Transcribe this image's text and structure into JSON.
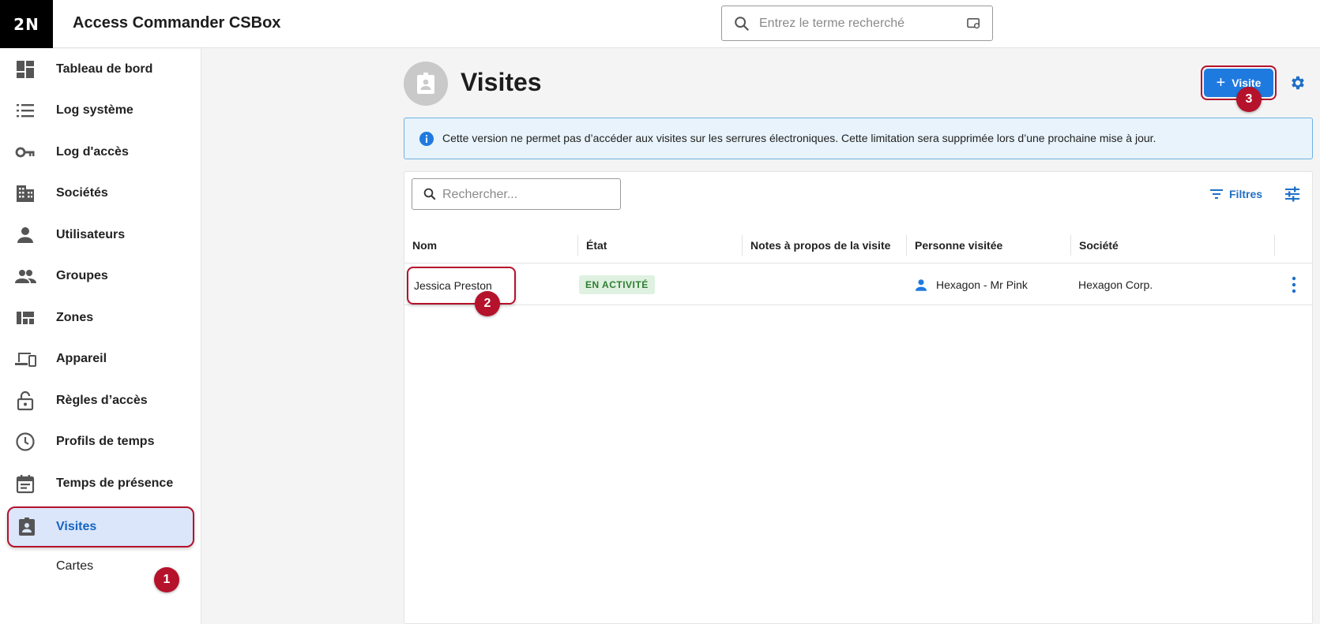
{
  "header": {
    "logo": "2N",
    "app_title": "Access Commander CSBox",
    "search_placeholder": "Entrez le terme recherché"
  },
  "sidebar": {
    "items": [
      {
        "label": "Tableau de bord",
        "icon": "dashboard-icon"
      },
      {
        "label": "Log système",
        "icon": "list-icon"
      },
      {
        "label": "Log d'accès",
        "icon": "key-icon"
      },
      {
        "label": "Sociétés",
        "icon": "building-icon"
      },
      {
        "label": "Utilisateurs",
        "icon": "person-icon"
      },
      {
        "label": "Groupes",
        "icon": "people-icon"
      },
      {
        "label": "Zones",
        "icon": "zones-icon"
      },
      {
        "label": "Appareil",
        "icon": "devices-icon"
      },
      {
        "label": "Règles d’accès",
        "icon": "lock-open-icon"
      },
      {
        "label": "Profils de temps",
        "icon": "clock-icon"
      },
      {
        "label": "Temps de présence",
        "icon": "calendar-icon"
      },
      {
        "label": "Visites",
        "icon": "badge-icon",
        "active": true
      },
      {
        "label": "Cartes"
      }
    ]
  },
  "page": {
    "title": "Visites",
    "add_button": "Visite",
    "info": "Cette version ne permet pas d’accéder aux visites sur les serrures électroniques. Cette limitation sera supprimée lors d’une prochaine mise à jour."
  },
  "table": {
    "search_placeholder": "Rechercher...",
    "filters_label": "Filtres",
    "columns": [
      "Nom",
      "État",
      "Notes à propos de la visite",
      "Personne visitée",
      "Société"
    ],
    "rows": [
      {
        "nom": "Jessica Preston",
        "etat": "EN ACTIVITÉ",
        "notes": "",
        "personne": "Hexagon - Mr Pink",
        "societe": "Hexagon Corp."
      }
    ]
  },
  "annotations": {
    "one": "1",
    "two": "2",
    "three": "3"
  },
  "colors": {
    "accent": "#1f7ae0",
    "annotation": "#b5122b",
    "active_bg": "#dbe6fb",
    "status_bg": "#dff1e0",
    "status_fg": "#2e7d32"
  }
}
